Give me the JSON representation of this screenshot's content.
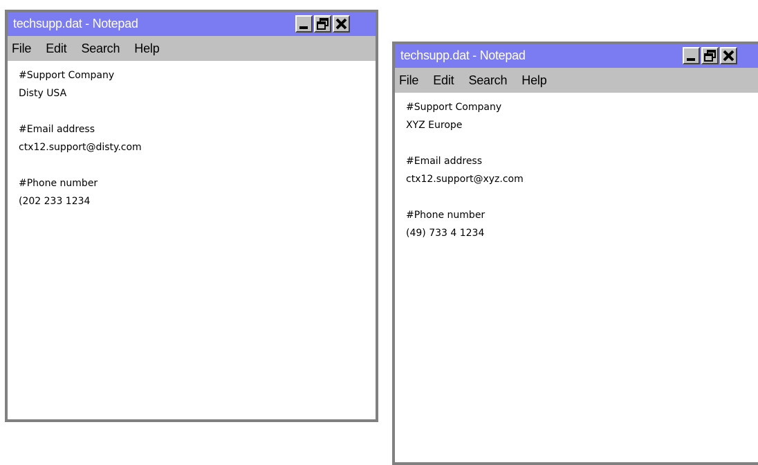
{
  "windows": [
    {
      "title": "techsupp.dat - Notepad",
      "menu": [
        "File",
        "Edit",
        "Search",
        "Help"
      ],
      "lines": {
        "company_header": "#Support Company",
        "company": "Disty USA",
        "email_header": "#Email address",
        "email": "ctx12.support@disty.com",
        "phone_header": "#Phone number",
        "phone": "(202 233 1234"
      }
    },
    {
      "title": "techsupp.dat - Notepad",
      "menu": [
        "File",
        "Edit",
        "Search",
        "Help"
      ],
      "lines": {
        "company_header": "#Support Company",
        "company": "XYZ Europe",
        "email_header": "#Email address",
        "email": "ctx12.support@xyz.com",
        "phone_header": "#Phone number",
        "phone": "(49) 733 4 1234"
      }
    }
  ],
  "colors": {
    "titlebar": "#7b7bf2",
    "menubar": "#c0c0c0",
    "frame": "#808080"
  },
  "icons": [
    "minimize-icon",
    "restore-icon",
    "close-icon"
  ]
}
